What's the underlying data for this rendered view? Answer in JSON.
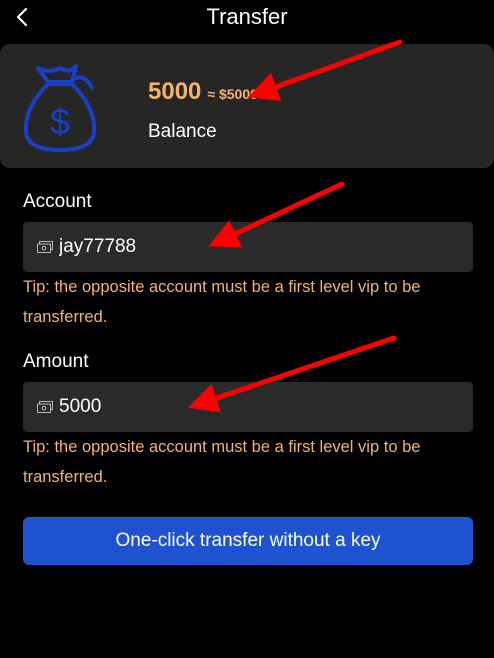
{
  "header": {
    "title": "Transfer",
    "back_icon": "chevron-left-icon"
  },
  "balance": {
    "amount": "5000",
    "approx": "≈ $5000",
    "label": "Balance",
    "icon": "money-bag-icon"
  },
  "account": {
    "label": "Account",
    "value": "jay77788",
    "icon": "ticket-icon",
    "tip": "Tip: the opposite account must be a first level vip to be transferred."
  },
  "amount": {
    "label": "Amount",
    "value": "5000",
    "icon": "ticket-icon",
    "tip": "Tip: the opposite account must be a first level vip to be transferred."
  },
  "action": {
    "label": "One-click transfer without a key"
  },
  "colors": {
    "accent": "#f5b26b",
    "button": "#1f52d0",
    "card": "#262626",
    "annotation": "#ff0000"
  }
}
